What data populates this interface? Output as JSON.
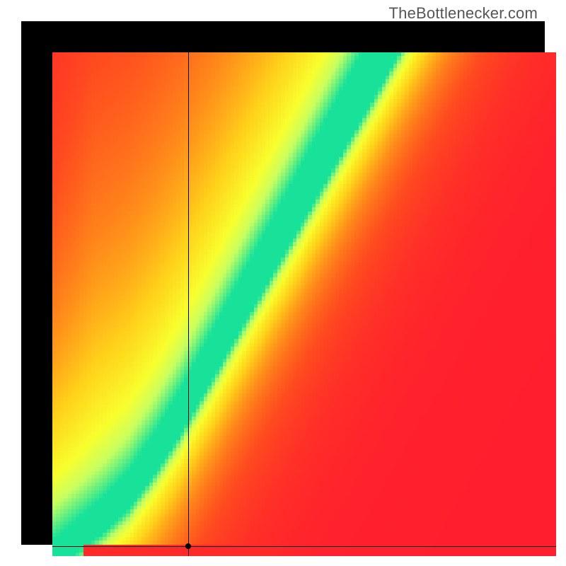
{
  "watermark": "TheBottlenecker.com",
  "chart_data": {
    "type": "heatmap",
    "title": "",
    "xlabel": "",
    "ylabel": "",
    "xlim": [
      0,
      100
    ],
    "ylim": [
      0,
      100
    ],
    "grid": false,
    "legend": false,
    "annotations": [],
    "note": "Values on 0–100% axes; scalar field encodes bottleneck-fit where 100 = ideal balance (green) down through yellow/orange to 0 = severe mismatch (red). Field is derived from a diagonal ridge of optimal pairing that curves near the origin and steepens toward the top-right.",
    "colorscale": [
      {
        "t": 0.0,
        "hex": "#ff1e2d"
      },
      {
        "t": 0.2,
        "hex": "#ff4b1f"
      },
      {
        "t": 0.4,
        "hex": "#ff8c1a"
      },
      {
        "t": 0.6,
        "hex": "#ffd21a"
      },
      {
        "t": 0.78,
        "hex": "#f8ff2e"
      },
      {
        "t": 0.88,
        "hex": "#c8ff60"
      },
      {
        "t": 1.0,
        "hex": "#18e29a"
      }
    ],
    "ridge": {
      "description": "y-position of the 100%-match ridge as a function of x (both 0..100)",
      "points": [
        {
          "x": 0,
          "y": 0
        },
        {
          "x": 5,
          "y": 4
        },
        {
          "x": 10,
          "y": 8
        },
        {
          "x": 15,
          "y": 13
        },
        {
          "x": 20,
          "y": 20
        },
        {
          "x": 25,
          "y": 28
        },
        {
          "x": 30,
          "y": 37
        },
        {
          "x": 35,
          "y": 46
        },
        {
          "x": 40,
          "y": 55
        },
        {
          "x": 45,
          "y": 64
        },
        {
          "x": 50,
          "y": 73
        },
        {
          "x": 55,
          "y": 82
        },
        {
          "x": 60,
          "y": 91
        },
        {
          "x": 65,
          "y": 100
        }
      ],
      "half_width_base": 3.0,
      "half_width_slope": 0.06
    },
    "falloff": {
      "below_ridge_scale": 18,
      "above_ridge_scale": 55,
      "corner_pull": 0.35
    },
    "marker": {
      "x": 27,
      "y": 2
    },
    "resolution": 130
  }
}
